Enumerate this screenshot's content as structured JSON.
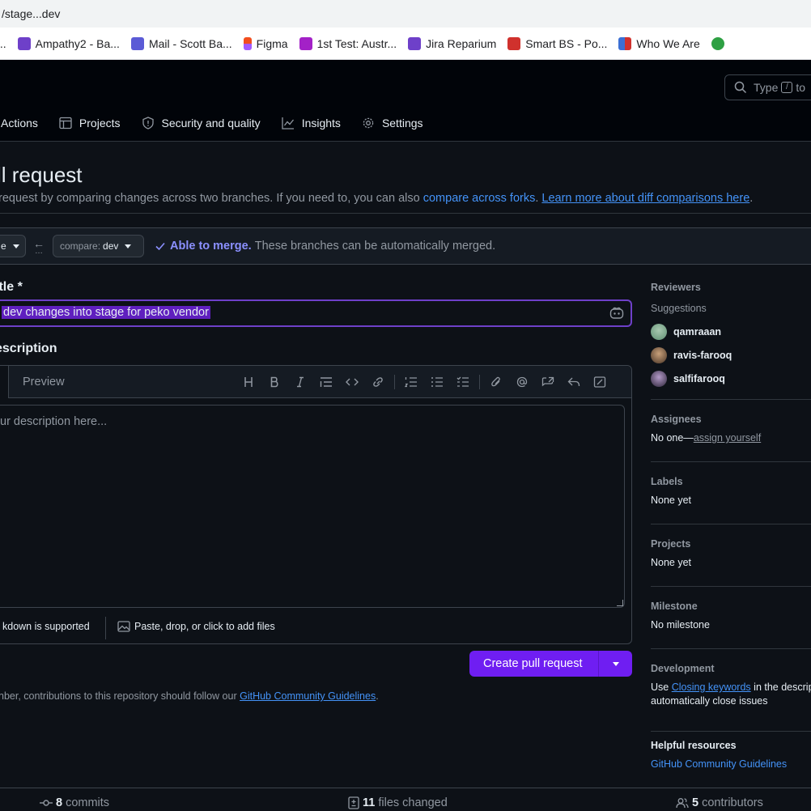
{
  "browser": {
    "url": "/stage...dev",
    "bookmarks": [
      {
        "label": "...",
        "color": "#7b61ff"
      },
      {
        "label": "Ampathy2 - Ba...",
        "color": "#6e40c9"
      },
      {
        "label": "Mail - Scott Ba...",
        "color": "#5b5bd6"
      },
      {
        "label": "Figma",
        "color": "#f24e1e"
      },
      {
        "label": "1st Test: Austr...",
        "color": "#a321c7"
      },
      {
        "label": "Jira Reparium",
        "color": "#6e40c9"
      },
      {
        "label": "Smart BS - Po...",
        "color": "#d0312d"
      },
      {
        "label": "Who We Are",
        "color": "#3b6fd4"
      },
      {
        "label": "",
        "color": "#2ea043"
      }
    ]
  },
  "header": {
    "search_placeholder_a": "Type",
    "search_key": "/",
    "search_placeholder_b": "to"
  },
  "nav": {
    "items": [
      {
        "label": "Actions",
        "icon": "actions-icon"
      },
      {
        "label": "Projects",
        "icon": "table-icon"
      },
      {
        "label": "Security and quality",
        "icon": "shield-icon"
      },
      {
        "label": "Insights",
        "icon": "graph-icon"
      },
      {
        "label": "Settings",
        "icon": "gear-icon"
      }
    ]
  },
  "page": {
    "title": "ll request",
    "subtitle_text": "request by comparing changes across two branches. If you need to, you can also",
    "subtitle_link1": "compare across forks",
    "subtitle_sep": ".",
    "subtitle_link2": "Learn more about diff comparisons here",
    "subtitle_end": "."
  },
  "compare": {
    "base_label": "e",
    "compare_prefix": "compare:",
    "compare_branch": "dev",
    "merge_ok": "Able to merge.",
    "merge_text": "These branches can be automatically merged."
  },
  "form": {
    "title_label": "itle *",
    "title_value": "dev changes into stage for peko vendor",
    "desc_label": "escription",
    "preview_tab": "Preview",
    "placeholder": "ur description here...",
    "markdown_note": "kdown is supported",
    "attach_note": "Paste, drop, or click to add files",
    "create_button": "Create pull request",
    "guide_text": "nber, contributions to this repository should follow our",
    "guide_link": "GitHub Community Guidelines",
    "guide_end": ".",
    "toolbar_icons": [
      "heading-icon",
      "bold-icon",
      "italic-icon",
      "quote-icon",
      "code-icon",
      "link-icon",
      "ordered-list-icon",
      "unordered-list-icon",
      "task-list-icon",
      "attach-icon",
      "mention-icon",
      "cross-reference-icon",
      "reply-icon",
      "fullscreen-icon"
    ]
  },
  "sidebar": {
    "reviewers_label": "Reviewers",
    "suggestions_label": "Suggestions",
    "reviewers": [
      {
        "name": "qamraaan",
        "color": "#7aa58a"
      },
      {
        "name": "ravis-farooq",
        "color": "#8a6a4f"
      },
      {
        "name": "salfifarooq",
        "color": "#6b5a7a"
      }
    ],
    "assignees_label": "Assignees",
    "assignees_value": "No one—",
    "assignees_link": "assign yourself",
    "labels_label": "Labels",
    "labels_value": "None yet",
    "projects_label": "Projects",
    "projects_value": "None yet",
    "milestone_label": "Milestone",
    "milestone_value": "No milestone",
    "development_label": "Development",
    "development_pre": "Use",
    "development_link": "Closing keywords",
    "development_post": "in the descrip",
    "development_line2": "automatically close issues",
    "helpful_label": "Helpful resources",
    "helpful_link": "GitHub Community Guidelines"
  },
  "stats": {
    "commits_count": "8",
    "commits_label": "commits",
    "files_count": "11",
    "files_label": "files changed",
    "contributors_count": "5",
    "contributors_label": "contributors"
  }
}
